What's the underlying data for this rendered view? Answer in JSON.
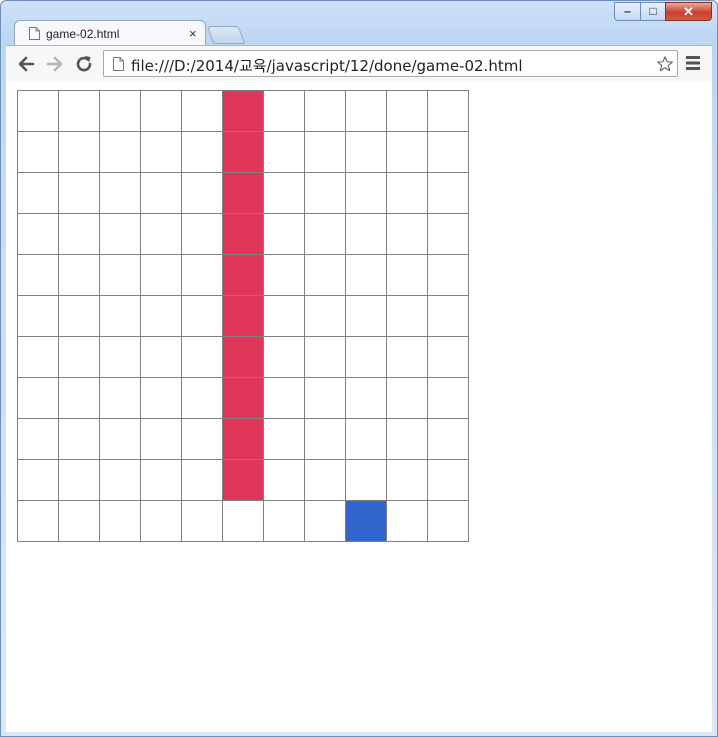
{
  "window": {
    "tab_title": "game-02.html",
    "close_tab_glyph": "×",
    "controls": {
      "minimize": "–",
      "maximize": "□",
      "close": "✕"
    }
  },
  "toolbar": {
    "url": "file:///D:/2014/교육/javascript/12/done/game-02.html",
    "icons": [
      "back-arrow-icon",
      "forward-arrow-icon",
      "reload-icon",
      "page-icon",
      "star-icon",
      "menu-icon"
    ]
  },
  "board": {
    "columns": 11,
    "rows": 11,
    "colors": {
      "empty": "#ffffff",
      "red": "#e0355a",
      "blue": "#3366cc",
      "grid": "#808080"
    },
    "cells": [
      [
        0,
        0,
        0,
        0,
        0,
        1,
        0,
        0,
        0,
        0,
        0
      ],
      [
        0,
        0,
        0,
        0,
        0,
        1,
        0,
        0,
        0,
        0,
        0
      ],
      [
        0,
        0,
        0,
        0,
        0,
        1,
        0,
        0,
        0,
        0,
        0
      ],
      [
        0,
        0,
        0,
        0,
        0,
        1,
        0,
        0,
        0,
        0,
        0
      ],
      [
        0,
        0,
        0,
        0,
        0,
        1,
        0,
        0,
        0,
        0,
        0
      ],
      [
        0,
        0,
        0,
        0,
        0,
        1,
        0,
        0,
        0,
        0,
        0
      ],
      [
        0,
        0,
        0,
        0,
        0,
        1,
        0,
        0,
        0,
        0,
        0
      ],
      [
        0,
        0,
        0,
        0,
        0,
        1,
        0,
        0,
        0,
        0,
        0
      ],
      [
        0,
        0,
        0,
        0,
        0,
        1,
        0,
        0,
        0,
        0,
        0
      ],
      [
        0,
        0,
        0,
        0,
        0,
        1,
        0,
        0,
        0,
        0,
        0
      ],
      [
        0,
        0,
        0,
        0,
        0,
        0,
        0,
        0,
        2,
        0,
        0
      ]
    ],
    "legend": {
      "0": "empty",
      "1": "red",
      "2": "blue"
    }
  }
}
